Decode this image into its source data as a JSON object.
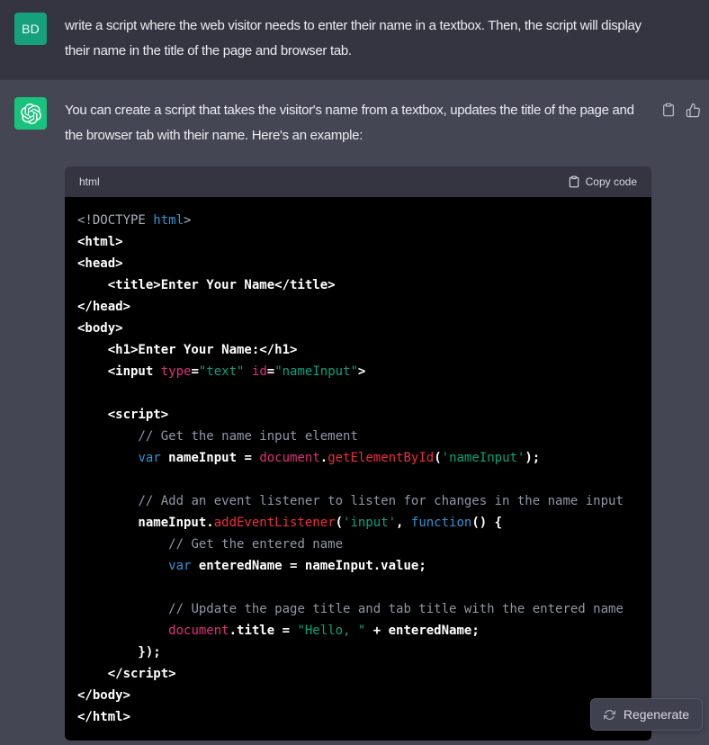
{
  "user_message": {
    "avatar_initials": "BD",
    "text": "write a script where the web visitor needs to enter their name in a textbox. Then, the script will display their name in the title of the page and browser tab."
  },
  "assistant_message": {
    "intro_text": "You can create a script that takes the visitor's name from a textbox, updates the title of the page and the browser tab with their name. Here's an example:",
    "code_block": {
      "language_label": "html",
      "copy_button_label": "Copy code",
      "lines": [
        [
          [
            "<!DOCTYPE ",
            "m"
          ],
          [
            "html",
            "k"
          ],
          [
            ">",
            "m"
          ]
        ],
        [
          [
            "<html>",
            "p"
          ]
        ],
        [
          [
            "<head>",
            "p"
          ]
        ],
        [
          [
            "    <title>Enter Your Name</title>",
            "p"
          ]
        ],
        [
          [
            "</head>",
            "p"
          ]
        ],
        [
          [
            "<body>",
            "p"
          ]
        ],
        [
          [
            "    <h1>Enter Your Name:</h1>",
            "p"
          ]
        ],
        [
          [
            "    <input ",
            "p"
          ],
          [
            "type",
            "v"
          ],
          [
            "=",
            "p"
          ],
          [
            "\"text\"",
            "s"
          ],
          [
            " ",
            "p"
          ],
          [
            "id",
            "v"
          ],
          [
            "=",
            "p"
          ],
          [
            "\"nameInput\"",
            "s"
          ],
          [
            ">",
            "p"
          ]
        ],
        [],
        [
          [
            "    <script>",
            "p"
          ]
        ],
        [
          [
            "        ",
            "p"
          ],
          [
            "// Get the name input element",
            "c"
          ]
        ],
        [
          [
            "        ",
            "p"
          ],
          [
            "var",
            "k"
          ],
          [
            " nameInput = ",
            "p"
          ],
          [
            "document",
            "v"
          ],
          [
            ".",
            "p"
          ],
          [
            "getElementById",
            "t"
          ],
          [
            "(",
            "p"
          ],
          [
            "'nameInput'",
            "s"
          ],
          [
            ");",
            "p"
          ]
        ],
        [],
        [
          [
            "        ",
            "p"
          ],
          [
            "// Add an event listener to listen for changes in the name input",
            "c"
          ]
        ],
        [
          [
            "        nameInput.",
            "p"
          ],
          [
            "addEventListener",
            "t"
          ],
          [
            "(",
            "p"
          ],
          [
            "'input'",
            "s"
          ],
          [
            ", ",
            "p"
          ],
          [
            "function",
            "k"
          ],
          [
            "() {",
            "p"
          ]
        ],
        [
          [
            "            ",
            "p"
          ],
          [
            "// Get the entered name",
            "c"
          ]
        ],
        [
          [
            "            ",
            "p"
          ],
          [
            "var",
            "k"
          ],
          [
            " enteredName = nameInput.value;",
            "p"
          ]
        ],
        [],
        [
          [
            "            ",
            "p"
          ],
          [
            "// Update the page title and tab title with the entered name",
            "c"
          ]
        ],
        [
          [
            "            ",
            "p"
          ],
          [
            "document",
            "v"
          ],
          [
            ".title = ",
            "p"
          ],
          [
            "\"Hello, \"",
            "s"
          ],
          [
            " + enteredName;",
            "p"
          ]
        ],
        [
          [
            "        });",
            "p"
          ]
        ],
        [
          [
            "    </script>",
            "p"
          ]
        ],
        [
          [
            "</body>",
            "p"
          ]
        ],
        [
          [
            "</html>",
            "p"
          ]
        ]
      ]
    }
  },
  "regenerate": {
    "label": "Regenerate"
  },
  "icons": {
    "assistant_avatar": "openai-logo-icon",
    "message_actions": [
      "clipboard-icon",
      "thumbs-up-icon"
    ],
    "copy_code": "clipboard-icon",
    "regenerate": "refresh-icon"
  },
  "colors": {
    "user_row_bg": "#343541",
    "assistant_row_bg": "#444654",
    "user_avatar_bg": "#16a07c",
    "assistant_avatar_bg": "#19c37d",
    "code_header_bg": "#343541",
    "code_bg": "#000000",
    "text_primary": "#ececf1",
    "code_keyword": "#2e95d3",
    "code_string": "#00a67d",
    "code_function": "#f22c3d",
    "code_variable": "#df3079",
    "code_comment": "#8e98a8"
  }
}
